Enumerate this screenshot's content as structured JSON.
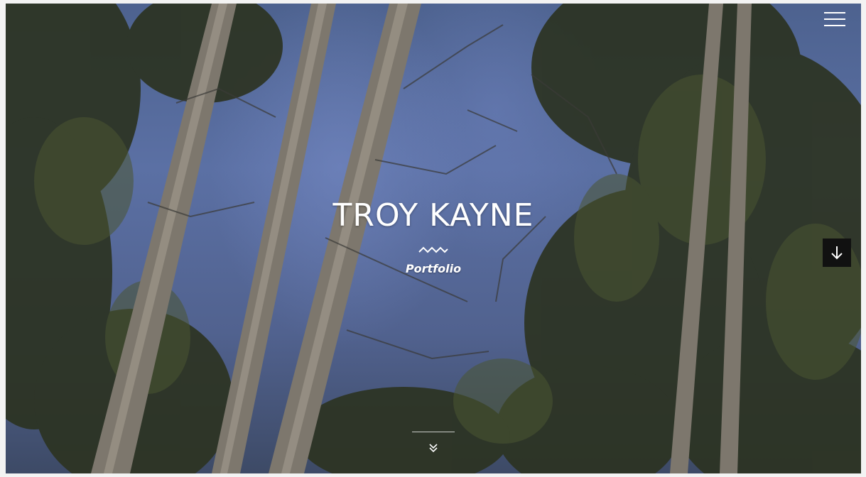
{
  "hero": {
    "title": "TROY KAYNE",
    "tagline": "Portfolio",
    "background_image": "pine-trees-blue-sky-icon"
  },
  "header": {
    "menu_icon": "hamburger-menu-icon"
  },
  "side_nav": {
    "arrow_icon": "arrow-down-icon"
  },
  "footer": {
    "scroll_icon": "double-chevron-down-icon"
  },
  "colors": {
    "text": "#ffffff",
    "side_arrow_bg": "#111111",
    "sky": "#5b70a4"
  }
}
